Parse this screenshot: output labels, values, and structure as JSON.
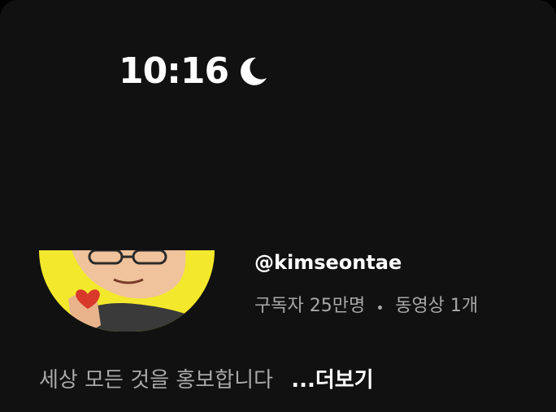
{
  "status_bar": {
    "time": "10:16",
    "focus_icon": "moon-icon"
  },
  "channel": {
    "avatar_icon": "avatar-illustration",
    "handle": "@kimseontae",
    "subscribers": "구독자 25만명",
    "videos": "동영상 1개",
    "description": "세상 모든 것을 홍보합니다",
    "more_label": "...더보기"
  },
  "colors": {
    "background": "#111111",
    "primary_text": "#ffffff",
    "secondary_text": "#a8a8a8",
    "avatar_bg": "#f3e82c"
  }
}
